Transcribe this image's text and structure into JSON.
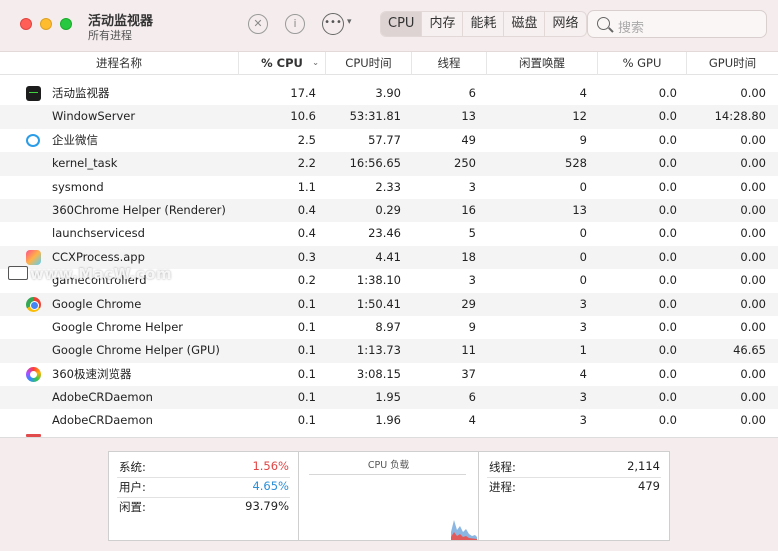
{
  "window": {
    "title": "活动监视器",
    "subtitle": "所有进程"
  },
  "toolbar": {
    "stop_icon": "x-circle-icon",
    "info_icon": "info-icon",
    "more_icon": "ellipsis-icon",
    "tabs": [
      "CPU",
      "内存",
      "能耗",
      "磁盘",
      "网络"
    ],
    "active_tab": "CPU",
    "search_placeholder": "搜索"
  },
  "columns": [
    "进程名称",
    "% CPU",
    "CPU时间",
    "线程",
    "闲置唤醒",
    "% GPU",
    "GPU时间"
  ],
  "sorted_column": "% CPU",
  "rows": [
    {
      "name": "活动监视器",
      "icon": "activity-monitor-icon",
      "cpu": "17.4",
      "cpu_time": "3.90",
      "threads": "6",
      "idle_wakeups": "4",
      "gpu": "0.0",
      "gpu_time": "0.00"
    },
    {
      "name": "WindowServer",
      "icon": "",
      "cpu": "10.6",
      "cpu_time": "53:31.81",
      "threads": "13",
      "idle_wakeups": "12",
      "gpu": "0.0",
      "gpu_time": "14:28.80"
    },
    {
      "name": "企业微信",
      "icon": "wecom-icon",
      "cpu": "2.5",
      "cpu_time": "57.77",
      "threads": "49",
      "idle_wakeups": "9",
      "gpu": "0.0",
      "gpu_time": "0.00"
    },
    {
      "name": "kernel_task",
      "icon": "",
      "cpu": "2.2",
      "cpu_time": "16:56.65",
      "threads": "250",
      "idle_wakeups": "528",
      "gpu": "0.0",
      "gpu_time": "0.00"
    },
    {
      "name": "sysmond",
      "icon": "",
      "cpu": "1.1",
      "cpu_time": "2.33",
      "threads": "3",
      "idle_wakeups": "0",
      "gpu": "0.0",
      "gpu_time": "0.00"
    },
    {
      "name": "360Chrome Helper (Renderer)",
      "icon": "",
      "cpu": "0.4",
      "cpu_time": "0.29",
      "threads": "16",
      "idle_wakeups": "13",
      "gpu": "0.0",
      "gpu_time": "0.00"
    },
    {
      "name": "launchservicesd",
      "icon": "",
      "cpu": "0.4",
      "cpu_time": "23.46",
      "threads": "5",
      "idle_wakeups": "0",
      "gpu": "0.0",
      "gpu_time": "0.00"
    },
    {
      "name": "CCXProcess.app",
      "icon": "ccx-icon",
      "cpu": "0.3",
      "cpu_time": "4.41",
      "threads": "18",
      "idle_wakeups": "0",
      "gpu": "0.0",
      "gpu_time": "0.00"
    },
    {
      "name": "gamecontrollerd",
      "icon": "",
      "cpu": "0.2",
      "cpu_time": "1:38.10",
      "threads": "3",
      "idle_wakeups": "0",
      "gpu": "0.0",
      "gpu_time": "0.00"
    },
    {
      "name": "Google Chrome",
      "icon": "chrome-icon",
      "cpu": "0.1",
      "cpu_time": "1:50.41",
      "threads": "29",
      "idle_wakeups": "3",
      "gpu": "0.0",
      "gpu_time": "0.00"
    },
    {
      "name": "Google Chrome Helper",
      "icon": "",
      "cpu": "0.1",
      "cpu_time": "8.97",
      "threads": "9",
      "idle_wakeups": "3",
      "gpu": "0.0",
      "gpu_time": "0.00"
    },
    {
      "name": "Google Chrome Helper (GPU)",
      "icon": "",
      "cpu": "0.1",
      "cpu_time": "1:13.73",
      "threads": "11",
      "idle_wakeups": "1",
      "gpu": "0.0",
      "gpu_time": "46.65"
    },
    {
      "name": "360极速浏览器",
      "icon": "360-browser-icon",
      "cpu": "0.1",
      "cpu_time": "3:08.15",
      "threads": "37",
      "idle_wakeups": "4",
      "gpu": "0.0",
      "gpu_time": "0.00"
    },
    {
      "name": "AdobeCRDaemon",
      "icon": "",
      "cpu": "0.1",
      "cpu_time": "1.95",
      "threads": "6",
      "idle_wakeups": "3",
      "gpu": "0.0",
      "gpu_time": "0.00"
    },
    {
      "name": "AdobeCRDaemon",
      "icon": "",
      "cpu": "0.1",
      "cpu_time": "1.96",
      "threads": "4",
      "idle_wakeups": "3",
      "gpu": "0.0",
      "gpu_time": "0.00"
    }
  ],
  "watermark": "www.MacW.com",
  "summary": {
    "system_label": "系统:",
    "system_value": "1.56%",
    "user_label": "用户:",
    "user_value": "4.65%",
    "idle_label": "闲置:",
    "idle_value": "93.79%",
    "load_title": "CPU 负载",
    "threads_label": "线程:",
    "threads_value": "2,114",
    "processes_label": "进程:",
    "processes_value": "479"
  },
  "colors": {
    "system": "#e04646",
    "user": "#2d8fd6",
    "toolbar_bg": "#f5eded"
  }
}
